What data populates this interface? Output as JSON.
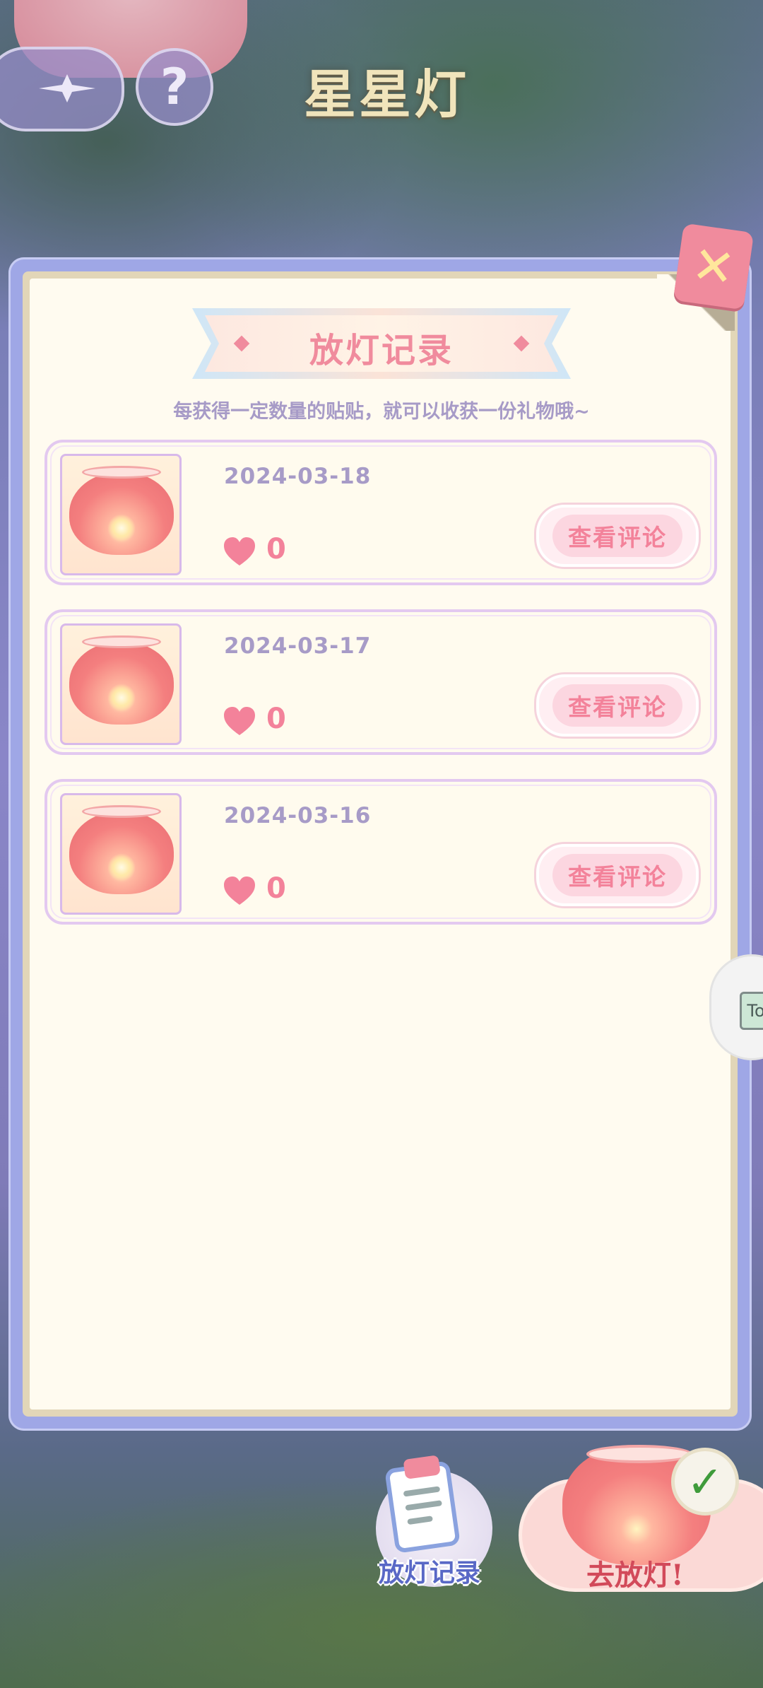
{
  "header": {
    "title": "星星灯"
  },
  "dialog": {
    "title": "放灯记录",
    "subtitle": "每获得一定数量的贴贴，就可以收获一份礼物哦~",
    "records": [
      {
        "date": "2024-03-18",
        "likes": "0",
        "button": "查看评论"
      },
      {
        "date": "2024-03-17",
        "likes": "0",
        "button": "查看评论"
      },
      {
        "date": "2024-03-16",
        "likes": "0",
        "button": "查看评论"
      }
    ]
  },
  "side_tab": {
    "label": "To"
  },
  "bottom": {
    "records_label": "放灯记录",
    "release_label": "去放灯!"
  },
  "colors": {
    "accent_pink": "#f08b9d",
    "text_purple": "#a79bc7",
    "panel_blue": "#9fa7e6"
  }
}
